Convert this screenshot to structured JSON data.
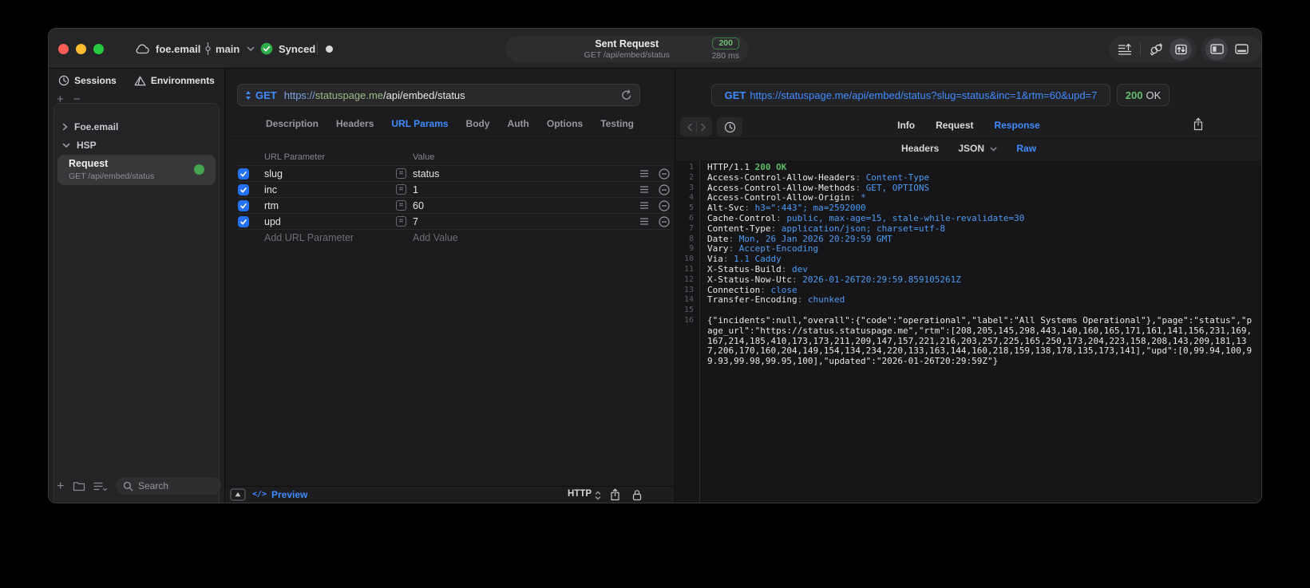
{
  "titlebar": {
    "workspace": "foe.email",
    "branch": "main",
    "sync_status": "Synced",
    "request_status": {
      "title": "Sent Request",
      "subtitle": "GET /api/embed/status",
      "code": "200",
      "duration": "280 ms"
    },
    "icons": [
      "cloud-icon",
      "branch-icon",
      "chevron-down-icon",
      "sync-check-icon",
      "session-dot",
      "list-order-icon",
      "link-sync-icon",
      "request-response-icon",
      "layout-sidebar-icon",
      "layout-bottom-icon"
    ]
  },
  "sidebar": {
    "tabs": [
      {
        "label": "Sessions"
      },
      {
        "label": "Environments"
      }
    ],
    "tree": [
      {
        "label": "Foe.email"
      },
      {
        "label": "HSP"
      }
    ],
    "selected_request": {
      "title": "Request",
      "subtitle": "GET /api/embed/status"
    },
    "search_placeholder": "Search",
    "icons": [
      "clock-icon",
      "environments-icon",
      "plus-icon",
      "minus-icon",
      "folder-icon",
      "list-filter-icon",
      "search-icon"
    ]
  },
  "request_editor": {
    "method": "GET",
    "url_scheme": "https://",
    "url_host": "statuspage.me",
    "url_path": "/api/embed/status",
    "tabs": [
      "Description",
      "Headers",
      "URL Params",
      "Body",
      "Auth",
      "Options",
      "Testing"
    ],
    "active_tab": "URL Params",
    "params": {
      "col_name": "URL Parameter",
      "col_value": "Value",
      "rows": [
        {
          "name": "slug",
          "value": "status",
          "enabled": true
        },
        {
          "name": "inc",
          "value": "1",
          "enabled": true
        },
        {
          "name": "rtm",
          "value": "60",
          "enabled": true
        },
        {
          "name": "upd",
          "value": "7",
          "enabled": true
        }
      ],
      "add_name": "Add URL Parameter",
      "add_value": "Add Value"
    },
    "footer": {
      "code_glyph": "</>",
      "preview": "Preview",
      "protocol": "HTTP"
    }
  },
  "response_viewer": {
    "method": "GET",
    "request_url": "https://statuspage.me/api/embed/status?slug=status&inc=1&rtm=60&upd=7",
    "status_code": "200",
    "status_text": "OK",
    "tabs": [
      "Info",
      "Request",
      "Response"
    ],
    "active_tab": "Response",
    "subtabs": [
      "Headers",
      "JSON",
      "Raw"
    ],
    "active_subtab": "Raw",
    "raw": {
      "status_line_protocol": "HTTP/1.1",
      "status_line_status": "200 OK",
      "headers": [
        {
          "name": "Access-Control-Allow-Headers",
          "value": "Content-Type"
        },
        {
          "name": "Access-Control-Allow-Methods",
          "value": "GET, OPTIONS"
        },
        {
          "name": "Access-Control-Allow-Origin",
          "value": "*"
        },
        {
          "name": "Alt-Svc",
          "value": "h3=\":443\"; ma=2592000"
        },
        {
          "name": "Cache-Control",
          "value": "public, max-age=15, stale-while-revalidate=30"
        },
        {
          "name": "Content-Type",
          "value": "application/json; charset=utf-8"
        },
        {
          "name": "Date",
          "value": "Mon, 26 Jan 2026 20:29:59 GMT"
        },
        {
          "name": "Vary",
          "value": "Accept-Encoding"
        },
        {
          "name": "Via",
          "value": "1.1 Caddy"
        },
        {
          "name": "X-Status-Build",
          "value": "dev"
        },
        {
          "name": "X-Status-Now-Utc",
          "value": "2026-01-26T20:29:59.859105261Z"
        },
        {
          "name": "Connection",
          "value": "close"
        },
        {
          "name": "Transfer-Encoding",
          "value": "chunked"
        }
      ],
      "body": {
        "incidents": null,
        "overall": {
          "code": "operational",
          "label": "All Systems Operational"
        },
        "page": "status",
        "page_url": "https://status.statuspage.me",
        "rtm": [
          208,
          205,
          145,
          298,
          443,
          140,
          160,
          165,
          171,
          161,
          141,
          156,
          231,
          169,
          167,
          214,
          185,
          410,
          173,
          173,
          211,
          209,
          147,
          157,
          221,
          216,
          203,
          257,
          225,
          165,
          250,
          173,
          204,
          223,
          158,
          208,
          143,
          209,
          181,
          137,
          206,
          170,
          160,
          204,
          149,
          154,
          134,
          234,
          220,
          133,
          163,
          144,
          160,
          218,
          159,
          138,
          178,
          135,
          173,
          141
        ],
        "upd": [
          0,
          99.94,
          100,
          99.93,
          99.98,
          99.95,
          100
        ],
        "updated": "2026-01-26T20:29:59Z"
      }
    },
    "icons": [
      "back-icon",
      "forward-icon",
      "history-clock-icon",
      "share-icon",
      "chevron-down-icon"
    ]
  },
  "colors": {
    "accent_blue": "#3f8cff",
    "success_green": "#43a34e",
    "status_green": "#66bd6d",
    "code_value_blue": "#4b9bf5",
    "checkbox_blue": "#2571f4",
    "traffic_red": "#ff5f57",
    "traffic_yellow": "#febc2e",
    "traffic_green": "#28c840"
  }
}
